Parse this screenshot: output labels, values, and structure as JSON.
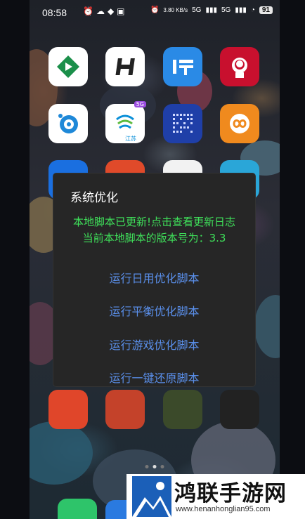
{
  "status_bar": {
    "time": "08:58",
    "speed": "3.80 KB/s",
    "signal1": "5G",
    "signal2": "5G",
    "battery": "91"
  },
  "apps_row1": [
    "app-icon-iqiyi-green",
    "app-icon-h-logo",
    "app-icon-blue-app",
    "app-icon-kfc"
  ],
  "apps_row2": [
    "app-icon-bird",
    "app-icon-china-mobile",
    "app-icon-grid-app",
    "app-icon-orange-loop"
  ],
  "app_labels": {
    "china_mobile_sub": "江苏",
    "china_mobile_badge": "5G"
  },
  "dialog": {
    "title": "系统优化",
    "message_line1": "本地脚本已更新!点击查看更新日志",
    "message_line2": "当前本地脚本的版本号为：3.3",
    "options": [
      "运行日用优化脚本",
      "运行平衡优化脚本",
      "运行游戏优化脚本",
      "运行一键还原脚本"
    ]
  },
  "watermark": {
    "title": "鸿联手游网",
    "url": "www.henanhonglian95.com"
  },
  "colors": {
    "dialog_bg": "#262626",
    "message_green": "#3fe05a",
    "option_blue": "#5a8fea"
  }
}
